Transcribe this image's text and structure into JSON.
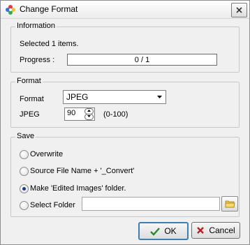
{
  "window": {
    "title": "Change Format"
  },
  "information": {
    "legend": "Information",
    "selected_text": "Selected 1 items.",
    "progress_label": "Progress :",
    "progress_value": "0 / 1",
    "progress_fraction": 0
  },
  "format": {
    "legend": "Format",
    "format_label": "Format",
    "format_selected": "JPEG",
    "quality_label": "JPEG",
    "quality_value": "90",
    "quality_range": "(0-100)"
  },
  "save": {
    "legend": "Save",
    "options": [
      {
        "label": "Overwrite",
        "checked": false
      },
      {
        "label": "Source File Name + '_Convert'",
        "checked": false
      },
      {
        "label": "Make 'Edited Images' folder.",
        "checked": true
      },
      {
        "label": "Select Folder",
        "checked": false
      }
    ],
    "folder_value": ""
  },
  "buttons": {
    "ok_label": "OK",
    "cancel_label": "Cancel"
  }
}
